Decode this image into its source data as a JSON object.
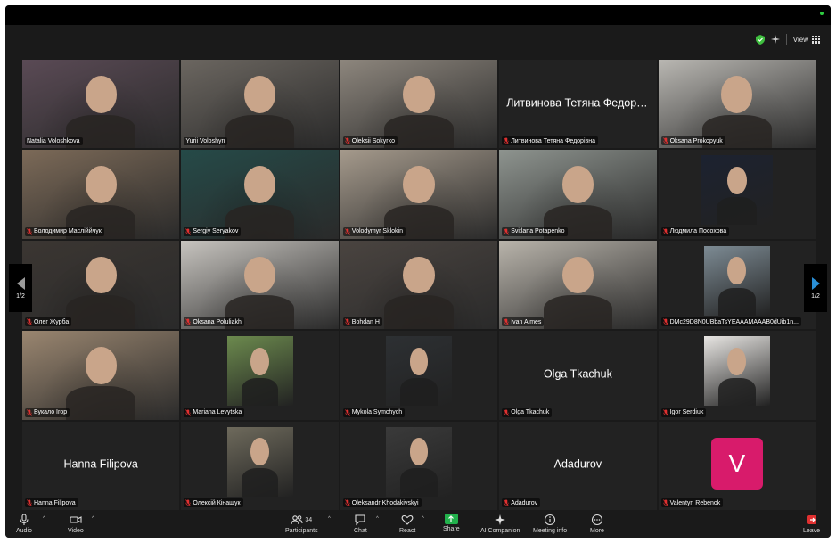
{
  "top_bar": {
    "view_label": "View"
  },
  "page": {
    "indicator": "1/2"
  },
  "tiles": [
    {
      "name": "Natalia Voloshkova",
      "muted": false,
      "active": true,
      "type": "video",
      "bg": "#5a4a55"
    },
    {
      "name": "Yurii Voloshyn",
      "muted": false,
      "type": "video",
      "bg": "#6b6660"
    },
    {
      "name": "Oleksii Sokyrko",
      "muted": true,
      "type": "video",
      "bg": "#8d867d"
    },
    {
      "name": "Литвинова Тетяна Федорівна",
      "muted": true,
      "type": "name",
      "display": "Литвинова Тетяна Федорів..."
    },
    {
      "name": "Oksana Prokopyuk",
      "muted": true,
      "type": "video",
      "bg": "#b9b7b2"
    },
    {
      "name": "Володимир Масліййчук",
      "muted": true,
      "type": "video",
      "bg": "#7c6a58"
    },
    {
      "name": "Sergiy Seryakov",
      "muted": true,
      "type": "video",
      "bg": "#254a48"
    },
    {
      "name": "Volodymyr Sklokin",
      "muted": true,
      "type": "video",
      "bg": "#a59a8c"
    },
    {
      "name": "Svitlana Potapenko",
      "muted": true,
      "type": "video",
      "bg": "#8e948f"
    },
    {
      "name": "Людмила Посохова",
      "muted": true,
      "type": "photo-dark",
      "bg": "#1c2230"
    },
    {
      "name": "Олег Журба",
      "muted": true,
      "type": "video",
      "bg": "#3b3632"
    },
    {
      "name": "Oksana Poluliakh",
      "muted": true,
      "type": "video",
      "bg": "#c7c4bf"
    },
    {
      "name": "Bohdan H",
      "muted": true,
      "type": "video",
      "bg": "#4a4440"
    },
    {
      "name": "Ivan Almes",
      "muted": true,
      "type": "video",
      "bg": "#b9b4ab"
    },
    {
      "name": "DMc29D8N0UBbaTsYEAAAMAAAB0dUib1n...",
      "muted": true,
      "type": "photo-small",
      "bg": "#7d8b94"
    },
    {
      "name": "Букало Ігор",
      "muted": true,
      "type": "video",
      "bg": "#9a8670"
    },
    {
      "name": "Mariana Levytska",
      "muted": true,
      "type": "photo-small",
      "bg": "#6c8a4e"
    },
    {
      "name": "Mykola Symchych",
      "muted": true,
      "type": "photo-small",
      "bg": "#2d3033"
    },
    {
      "name": "Olga Tkachuk",
      "muted": true,
      "type": "name",
      "display": "Olga Tkachuk"
    },
    {
      "name": "Igor Serdiuk",
      "muted": true,
      "type": "photo-small",
      "bg": "#e8e6e3"
    },
    {
      "name": "Hanna Filipova",
      "muted": true,
      "type": "name",
      "display": "Hanna Filipova"
    },
    {
      "name": "Олексій Кінащук",
      "muted": true,
      "type": "photo-small",
      "bg": "#6e6a5c"
    },
    {
      "name": "Oleksandr Khodakivskyi",
      "muted": true,
      "type": "photo-small",
      "bg": "#3a3a3a"
    },
    {
      "name": "Adadurov",
      "muted": true,
      "type": "name",
      "display": "Adadurov"
    },
    {
      "name": "Valentyn Rebenok",
      "muted": true,
      "type": "avatar",
      "initial": "V"
    }
  ],
  "toolbar": {
    "audio": "Audio",
    "video": "Video",
    "participants": "Participants",
    "participants_count": "34",
    "chat": "Chat",
    "react": "React",
    "share": "Share",
    "ai_companion": "AI Companion",
    "meeting_info": "Meeting info",
    "more": "More",
    "leave": "Leave"
  },
  "colors": {
    "active_border": "#3fbf3f",
    "muted_mic": "#e03030",
    "share_green": "#22b14c",
    "avatar_v": "#d81b6b"
  }
}
